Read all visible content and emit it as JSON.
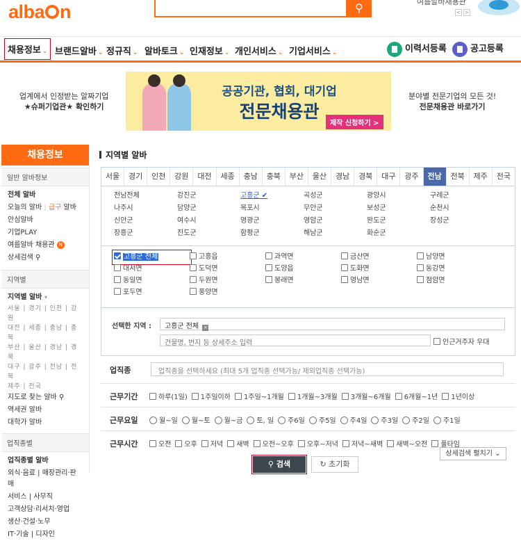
{
  "header": {
    "logo_prefix": "alba",
    "logo_suffix": "n",
    "search_icon": "search-icon",
    "ad_text": "여름알바채용관"
  },
  "gnb": {
    "items": [
      "채용정보",
      "브랜드알바",
      "정규직",
      "알바토크",
      "인재정보",
      "개인서비스",
      "기업서비스"
    ],
    "resume_button": "이력서등록",
    "post_button": "공고등록"
  },
  "banner_left": {
    "line1": "업계에서 인정받는 알짜기업",
    "line2": "★슈퍼기업관★ 확인하기"
  },
  "banner": {
    "title1": "공공기관, 협회, 대기업",
    "title2": "전문채용관",
    "cta": "제작 신청하기 >"
  },
  "banner_right": {
    "line1": "분야별 전문기업의 모든 것!",
    "line2": "전문채용관 바로가기"
  },
  "lnb": {
    "header": "채용정보",
    "sec1": "일반 알바정보",
    "all_jobs": "전체 알바",
    "today_prefix": "오늘의 알바",
    "today_sep": "|",
    "urgent": "급구",
    "today_suffix": "알바",
    "safe": "안심알바",
    "company_play": "기업PLAY",
    "summer": "여름알바 채용관",
    "summer_badge": "N",
    "detail_search": "상세검색",
    "sec2": "지역별",
    "region_jobs": "지역별 알바",
    "region_lines": [
      "서울 | 경기 | 인천 | 강원",
      "대전 | 세종 | 충남 | 충북",
      "부산 | 울산 | 경남 | 경북",
      "대구 | 광주 | 전남 | 전북",
      "제주 | 전국"
    ],
    "map_search": "지도로 찾는 알바",
    "station": "역세권 알바",
    "university": "대학가 알바",
    "sec3": "업직종별",
    "category_jobs": "업직종별 알바",
    "category_lines": [
      "외식·음료 | 매장관리·판매",
      "서비스 | 사무직",
      "고객상담·리서치·영업",
      "생산·건설·노무",
      "IT·기술 | 디자인"
    ]
  },
  "main": {
    "title": "지역별 알바",
    "region_tabs": [
      "서울",
      "경기",
      "인천",
      "강원",
      "대전",
      "세종",
      "충남",
      "충북",
      "부산",
      "울산",
      "경남",
      "경북",
      "대구",
      "광주",
      "전남",
      "전북",
      "제주",
      "전국"
    ],
    "active_tab": "전남",
    "cities": [
      "전남전체",
      "강진군",
      "고흥군 ✔",
      "곡성군",
      "광양시",
      "구례군",
      "나주시",
      "담양군",
      "목포시",
      "무안군",
      "보성군",
      "순천시",
      "신안군",
      "여수시",
      "영광군",
      "영암군",
      "완도군",
      "장성군",
      "장흥군",
      "진도군",
      "함평군",
      "해남군",
      "화순군"
    ],
    "selected_city": "고흥군 ✔",
    "towns": [
      "고흥군 전체",
      "고흥읍",
      "과역면",
      "금산면",
      "남양면",
      "대서면",
      "도덕면",
      "도양읍",
      "도화면",
      "동강면",
      "동일면",
      "두원면",
      "봉래면",
      "영남면",
      "점암면",
      "포두면",
      "풍양면"
    ],
    "selected_label": "선택한 지역 :",
    "selected_value": "고흥군 전체",
    "selected_remove": "×",
    "address_placeholder": "건물명, 번지 등 상세주소 입력",
    "abroad_label": "인근거주자 우대"
  },
  "filters": {
    "job_label": "업직종",
    "job_placeholder": "업직종을 선택하세요 (최대 5개 업직종 선택가능/ 제외업직종 선택가능)",
    "period_label": "근무기간",
    "period_options": [
      "하루(1일)",
      "1주일이하",
      "1주일~1개월",
      "1개월~3개월",
      "3개월~6개월",
      "6개월~1년",
      "1년이상"
    ],
    "days_label": "근무요일",
    "days_options": [
      "월~일",
      "월~토",
      "월~금",
      "토, 일",
      "주6일",
      "주5일",
      "주4일",
      "주3일",
      "주2일",
      "주1일"
    ],
    "time_label": "근무시간",
    "time_options": [
      "오전",
      "오후",
      "저녁",
      "새벽",
      "오전~오후",
      "오후~저녁",
      "저녁~새벽",
      "새벽~오전",
      "풀타임"
    ],
    "detail_toggle": "상세검색 펼치기 ⌄",
    "search_button": "검색",
    "reset_button": "초기화"
  }
}
